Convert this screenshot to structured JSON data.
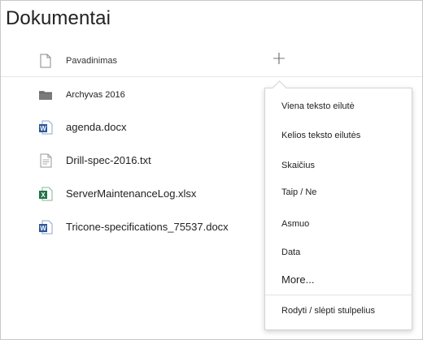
{
  "page": {
    "title": "Dokumentai"
  },
  "list": {
    "column_header": "Pavadinimas",
    "add_column_symbol": "+",
    "files": [
      {
        "name": "Archyvas 2016",
        "icon": "folder-icon",
        "style": "small"
      },
      {
        "name": "agenda.docx",
        "icon": "word-file-icon",
        "style": "normal"
      },
      {
        "name": "Drill-spec-2016.txt",
        "icon": "text-file-icon",
        "style": "normal"
      },
      {
        "name": "ServerMaintenanceLog.xlsx",
        "icon": "excel-file-icon",
        "style": "normal"
      },
      {
        "name": "Tricone-specifications_75537.docx",
        "icon": "word-file-icon",
        "style": "normal"
      }
    ]
  },
  "column_menu": {
    "items": [
      {
        "label": "Viena teksto eilutė"
      },
      {
        "label": "Kelios teksto eilutės"
      },
      {
        "label": "Skaičius"
      },
      {
        "label": "Taip / Ne"
      },
      {
        "label": "Asmuo"
      },
      {
        "label": "Data"
      },
      {
        "label": "More..."
      }
    ],
    "footer_item": "Rodyti / slėpti stulpelius"
  },
  "colors": {
    "word": "#2b579a",
    "excel": "#217346",
    "folder": "#7a7a7a",
    "border": "#c8c8c8"
  }
}
